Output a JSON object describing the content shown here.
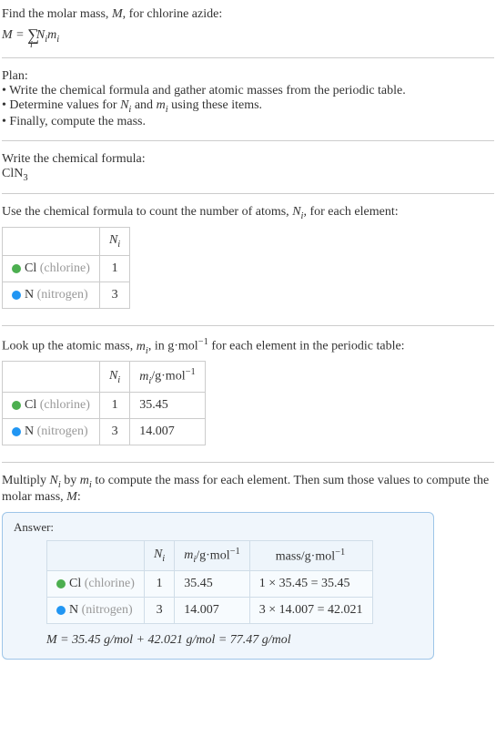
{
  "intro": {
    "line1": "Find the molar mass, M, for chlorine azide:",
    "formula": "M = ∑ᵢ Nᵢmᵢ"
  },
  "plan": {
    "heading": "Plan:",
    "b1": "• Write the chemical formula and gather atomic masses from the periodic table.",
    "b2": "• Determine values for Nᵢ and mᵢ using these items.",
    "b3": "• Finally, compute the mass."
  },
  "step1": {
    "heading": "Write the chemical formula:",
    "formula": "ClN₃"
  },
  "step2": {
    "heading": "Use the chemical formula to count the number of atoms, Nᵢ, for each element:",
    "header_n": "Nᵢ",
    "rows": [
      {
        "symbol": "Cl",
        "name": "(chlorine)",
        "n": "1"
      },
      {
        "symbol": "N",
        "name": "(nitrogen)",
        "n": "3"
      }
    ]
  },
  "step3": {
    "heading": "Look up the atomic mass, mᵢ, in g·mol⁻¹ for each element in the periodic table:",
    "header_n": "Nᵢ",
    "header_m": "mᵢ/g·mol⁻¹",
    "rows": [
      {
        "symbol": "Cl",
        "name": "(chlorine)",
        "n": "1",
        "m": "35.45"
      },
      {
        "symbol": "N",
        "name": "(nitrogen)",
        "n": "3",
        "m": "14.007"
      }
    ]
  },
  "step4": {
    "heading": "Multiply Nᵢ by mᵢ to compute the mass for each element. Then sum those values to compute the molar mass, M:"
  },
  "answer": {
    "label": "Answer:",
    "header_n": "Nᵢ",
    "header_m": "mᵢ/g·mol⁻¹",
    "header_mass": "mass/g·mol⁻¹",
    "rows": [
      {
        "symbol": "Cl",
        "name": "(chlorine)",
        "n": "1",
        "m": "35.45",
        "mass": "1 × 35.45 = 35.45"
      },
      {
        "symbol": "N",
        "name": "(nitrogen)",
        "n": "3",
        "m": "14.007",
        "mass": "3 × 14.007 = 42.021"
      }
    ],
    "final": "M = 35.45 g/mol + 42.021 g/mol = 77.47 g/mol"
  }
}
